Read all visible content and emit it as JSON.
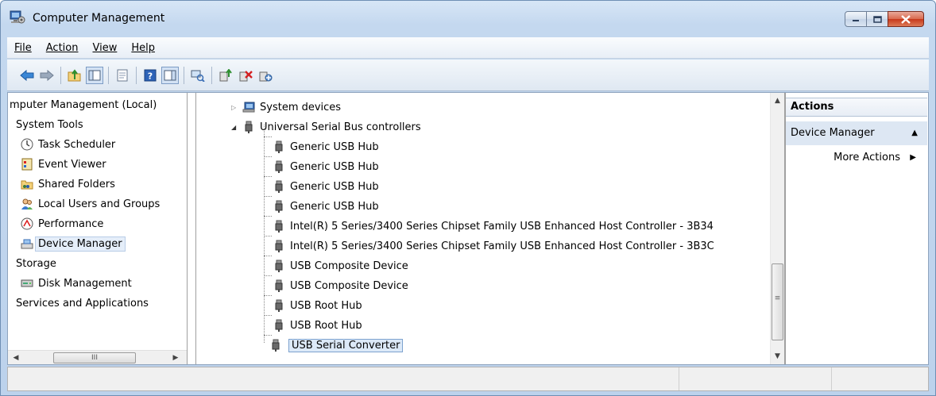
{
  "window": {
    "title": "Computer Management"
  },
  "menu": [
    "File",
    "Action",
    "View",
    "Help"
  ],
  "toolbar": {
    "buttons": [
      "back-arrow-icon",
      "forward-arrow-icon",
      "up-folder-icon",
      "show-hide-tree-icon",
      "properties-icon",
      "help-icon",
      "show-hide-action-pane-icon",
      "scan-hardware-icon",
      "update-driver-icon",
      "uninstall-icon",
      "disable-device-icon"
    ]
  },
  "left_tree": {
    "items": [
      {
        "label": "mputer Management (Local)",
        "icon": null
      },
      {
        "label": "System Tools",
        "icon": null
      },
      {
        "label": "Task Scheduler",
        "icon": "clock-icon"
      },
      {
        "label": "Event Viewer",
        "icon": "event-viewer-icon"
      },
      {
        "label": "Shared Folders",
        "icon": "shared-folder-icon"
      },
      {
        "label": "Local Users and Groups",
        "icon": "users-icon"
      },
      {
        "label": "Performance",
        "icon": "performance-icon"
      },
      {
        "label": "Device Manager",
        "icon": "device-manager-icon"
      },
      {
        "label": "Storage",
        "icon": null
      },
      {
        "label": "Disk Management",
        "icon": "disk-icon"
      },
      {
        "label": "Services and Applications",
        "icon": null
      }
    ],
    "scroll_label": "III"
  },
  "device_tree": {
    "system_devices": "System devices",
    "usb_controllers": "Universal Serial Bus controllers",
    "children": [
      "Generic USB Hub",
      "Generic USB Hub",
      "Generic USB Hub",
      "Generic USB Hub",
      "Intel(R) 5 Series/3400 Series Chipset Family USB Enhanced Host Controller - 3B34",
      "Intel(R) 5 Series/3400 Series Chipset Family USB Enhanced Host Controller - 3B3C",
      "USB Composite Device",
      "USB Composite Device",
      "USB Root Hub",
      "USB Root Hub",
      "USB Serial Converter"
    ],
    "selected": "USB Serial Converter"
  },
  "actions_pane": {
    "header": "Actions",
    "group": "Device Manager",
    "item": "More Actions"
  }
}
